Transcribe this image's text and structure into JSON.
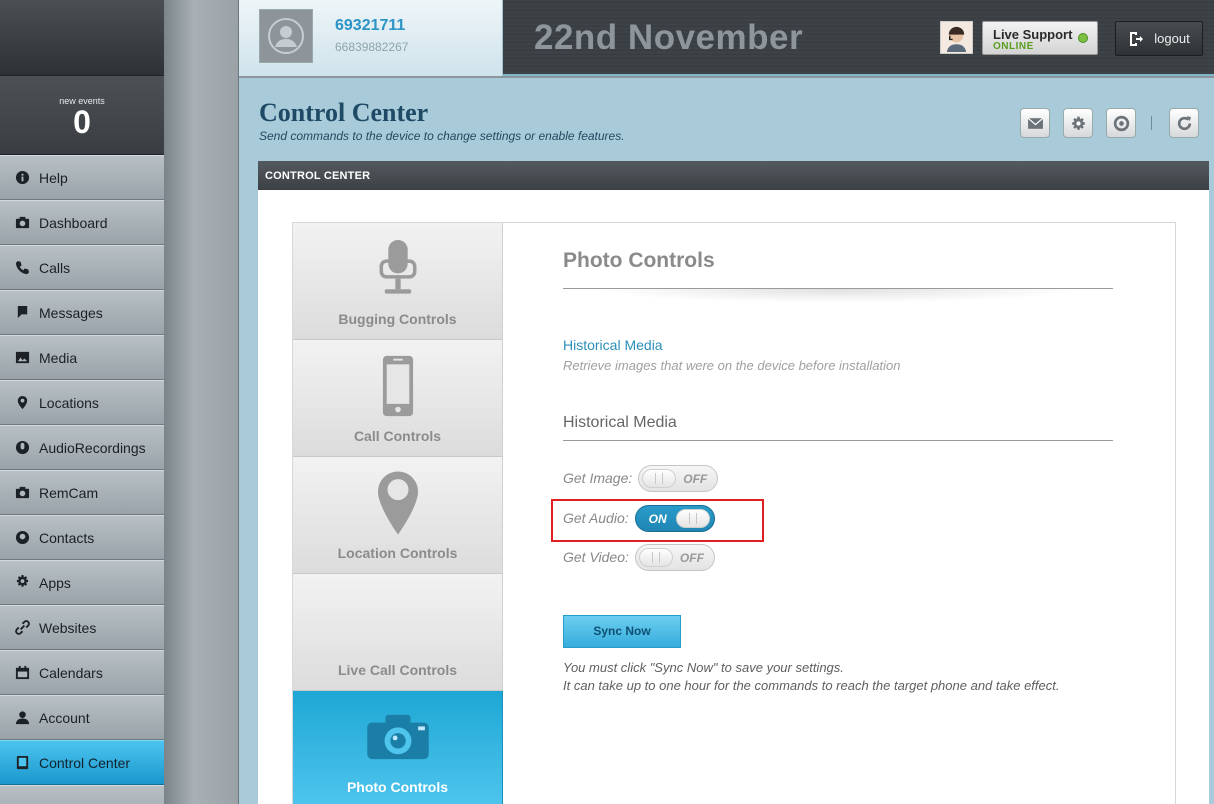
{
  "sidebar": {
    "events_label": "new events",
    "events_count": "0",
    "items": [
      {
        "label": "Help",
        "icon": "info-icon"
      },
      {
        "label": "Dashboard",
        "icon": "camera-icon"
      },
      {
        "label": "Calls",
        "icon": "phone-icon"
      },
      {
        "label": "Messages",
        "icon": "chat-icon"
      },
      {
        "label": "Media",
        "icon": "image-icon"
      },
      {
        "label": "Locations",
        "icon": "pin-icon"
      },
      {
        "label": "AudioRecordings",
        "icon": "mic-icon"
      },
      {
        "label": "RemCam",
        "icon": "camera-icon"
      },
      {
        "label": "Contacts",
        "icon": "contact-icon"
      },
      {
        "label": "Apps",
        "icon": "gear-icon"
      },
      {
        "label": "Websites",
        "icon": "link-icon"
      },
      {
        "label": "Calendars",
        "icon": "calendar-icon"
      },
      {
        "label": "Account",
        "icon": "user-icon"
      },
      {
        "label": "Control Center",
        "icon": "tablet-icon"
      }
    ],
    "active_item": "Control Center"
  },
  "header": {
    "device_number": "69321711",
    "device_imei": "66839882267",
    "date": "22nd November",
    "support_title": "Live Support",
    "support_status": "ONLINE",
    "logout_label": "logout"
  },
  "page": {
    "title": "Control Center",
    "subtitle": "Send commands to the device to change settings or enable features.",
    "panel_header": "CONTROL CENTER",
    "toolbar_icons": [
      "envelope-icon",
      "gear-icon",
      "at-icon",
      "refresh-icon"
    ]
  },
  "control_tabs": [
    {
      "label": "Bugging Controls",
      "icon": "microphone-icon"
    },
    {
      "label": "Call Controls",
      "icon": "mobile-phone-icon"
    },
    {
      "label": "Location Controls",
      "icon": "map-pin-icon"
    },
    {
      "label": "Live Call Controls",
      "icon": "none"
    },
    {
      "label": "Photo Controls",
      "icon": "camera-icon"
    }
  ],
  "photo_controls": {
    "title": "Photo Controls",
    "link": "Historical Media",
    "description": "Retrieve images that were on the device before installation",
    "section_heading": "Historical Media",
    "toggles": [
      {
        "label": "Get Image:",
        "state": "OFF"
      },
      {
        "label": "Get Audio:",
        "state": "ON"
      },
      {
        "label": "Get Video:",
        "state": "OFF"
      }
    ],
    "sync_label": "Sync Now",
    "note_line1": "You must click \"Sync Now\" to save your settings.",
    "note_line2": "It can take up to one hour for the commands to reach the target phone and take effect."
  },
  "colors": {
    "accent": "#2b9bcb",
    "active_tab": "#1ea7d4",
    "highlight": "#e02020",
    "support_online": "#7cc142"
  }
}
